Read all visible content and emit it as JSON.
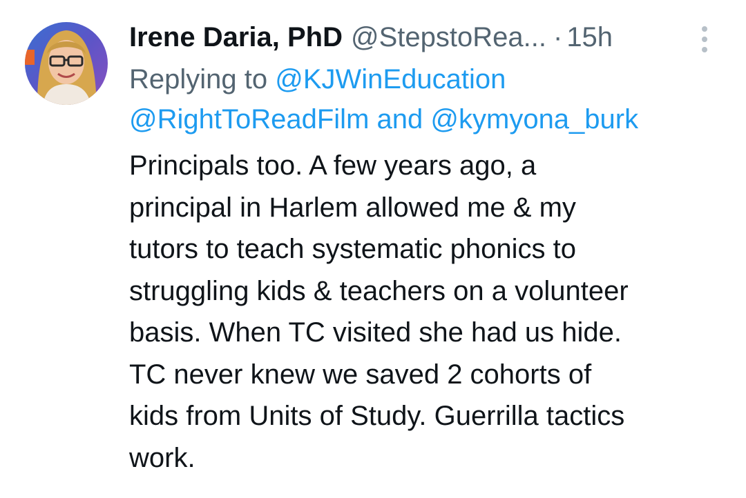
{
  "tweet": {
    "author_name": "Irene Daria, PhD",
    "author_handle": "@StepstoRea...",
    "separator": "·",
    "timestamp": "15h",
    "more_icon": "more-vertical-icon",
    "avatar_icon": "avatar",
    "replying_prefix": "Replying to",
    "reply_mentions": [
      "@KJWinEducation",
      "@RightToReadFilm",
      "@kymyona_burk"
    ],
    "reply_joiner": "and",
    "body_lines": [
      "Principals too. A few years ago, a",
      "principal in Harlem allowed me & my",
      "tutors to teach systematic phonics to",
      "struggling kids & teachers on a volunteer",
      "basis. When TC visited she had us hide.",
      "TC never knew we saved 2 cohorts of",
      "kids from Units of Study. Guerrilla tactics",
      "work."
    ]
  },
  "colors": {
    "text": "#0f1419",
    "secondary": "#536471",
    "link": "#1d9bf0",
    "more_dots": "#b7c0c8",
    "background": "#ffffff"
  }
}
